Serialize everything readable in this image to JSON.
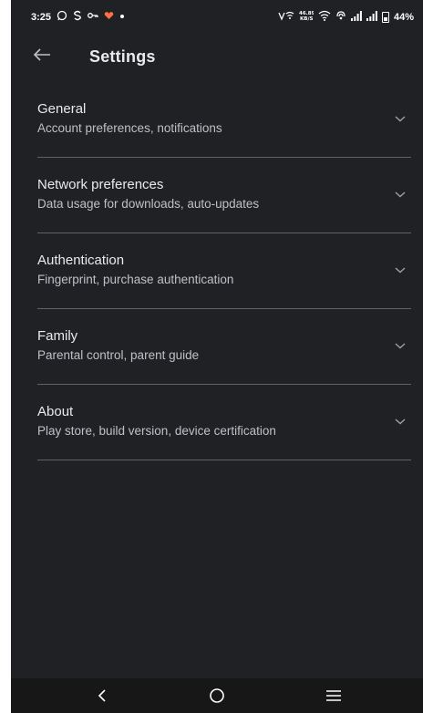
{
  "status_bar": {
    "time": "3:25",
    "battery": "44%",
    "left_icons": [
      "whatsapp-icon",
      "s-icon",
      "key-icon",
      "heart-icon",
      "dot-icon"
    ],
    "right_icons": [
      "vowifi-icon",
      "data-speed-icon",
      "wifi-icon",
      "hotspot-icon",
      "signal-icon",
      "signal-icon",
      "battery-icon"
    ],
    "data_speed": "46.89\nKB/S"
  },
  "header": {
    "title": "Settings",
    "back_icon": "back-arrow-icon"
  },
  "settings": [
    {
      "title": "General",
      "subtitle": "Account preferences, notifications"
    },
    {
      "title": "Network preferences",
      "subtitle": "Data usage for downloads, auto-updates"
    },
    {
      "title": "Authentication",
      "subtitle": "Fingerprint, purchase authentication"
    },
    {
      "title": "Family",
      "subtitle": "Parental control, parent guide"
    },
    {
      "title": "About",
      "subtitle": "Play store, build version, device certification"
    }
  ],
  "nav_bar": {
    "back": "nav-back-icon",
    "home": "nav-home-icon",
    "recents": "nav-menu-icon"
  },
  "colors": {
    "background": "#202124",
    "text_primary": "#e8eaed",
    "text_secondary": "#bdc1c6",
    "divider": "#5f6368",
    "nav_bar": "#171717"
  }
}
